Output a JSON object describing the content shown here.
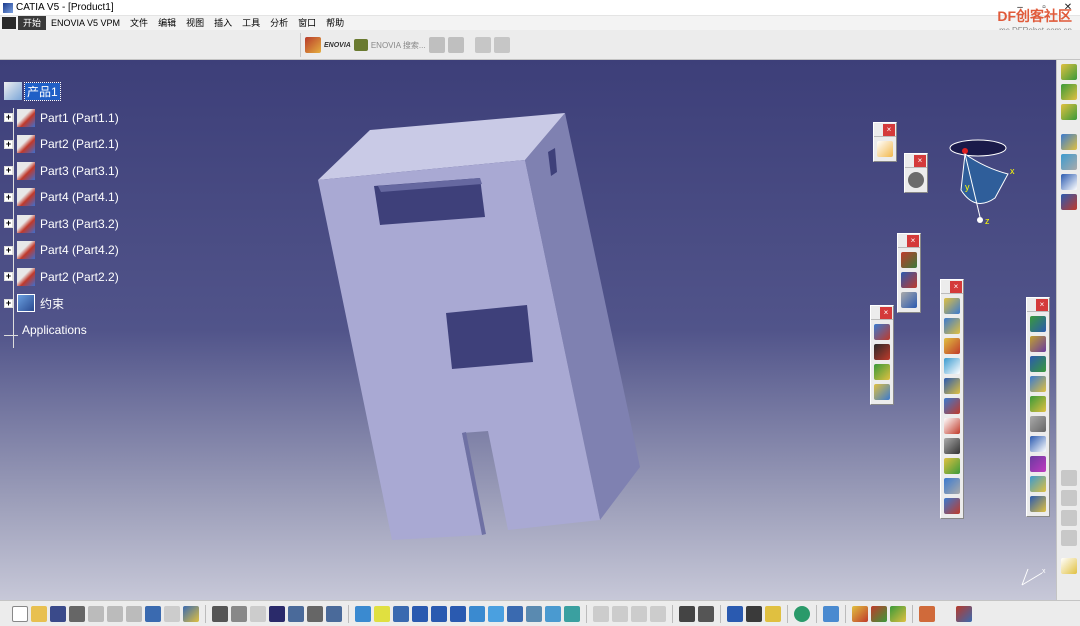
{
  "window": {
    "title": "CATIA V5 - [Product1]",
    "minimize": "–",
    "maximize": "▫",
    "close": "✕"
  },
  "menu": [
    "开始",
    "ENOVIA V5 VPM",
    "文件",
    "编辑",
    "视图",
    "插入",
    "工具",
    "分析",
    "窗口",
    "帮助"
  ],
  "watermark": {
    "brand": "DF创客社区",
    "url": "mc.DFRobot.com.cn"
  },
  "toptools": {
    "enovia_label": "ENOVIA",
    "search_label": "ENOVIA 搜索..."
  },
  "tree": {
    "root": "产品1",
    "items": [
      "Part1 (Part1.1)",
      "Part2 (Part2.1)",
      "Part3 (Part3.1)",
      "Part4 (Part4.1)",
      "Part3 (Part3.2)",
      "Part4 (Part4.2)",
      "Part2 (Part2.2)"
    ],
    "constraints": "约束",
    "applications": "Applications"
  },
  "floating_toolbars": {
    "close_glyph": "×"
  },
  "compass": {
    "x": "x",
    "y": "y",
    "z": "z"
  },
  "colors": {
    "viewport_top": "#3d3f79",
    "part_face": "#a9a9d3",
    "selection": "#1f5fc6"
  }
}
